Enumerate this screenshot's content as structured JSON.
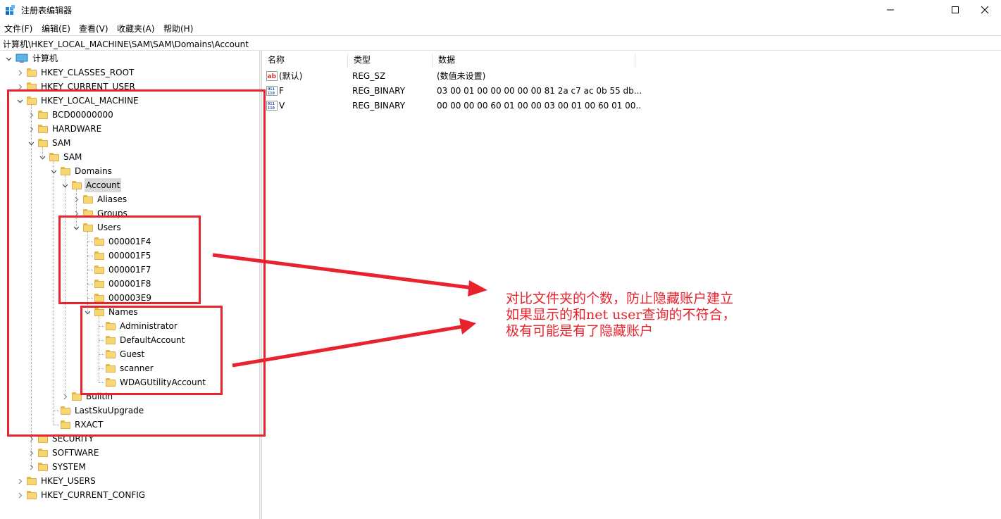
{
  "window": {
    "title": "注册表编辑器",
    "controls": [
      "—",
      "☐",
      "✕"
    ]
  },
  "menu": [
    "文件(F)",
    "编辑(E)",
    "查看(V)",
    "收藏夹(A)",
    "帮助(H)"
  ],
  "address": "计算机\\HKEY_LOCAL_MACHINE\\SAM\\SAM\\Domains\\Account",
  "tree": {
    "root": "计算机",
    "items": [
      {
        "label": "HKEY_CLASSES_ROOT",
        "depth": 1,
        "toggle": "collapsed"
      },
      {
        "label": "HKEY_CURRENT_USER",
        "depth": 1,
        "toggle": "collapsed"
      },
      {
        "label": "HKEY_LOCAL_MACHINE",
        "depth": 1,
        "toggle": "expanded"
      },
      {
        "label": "BCD00000000",
        "depth": 2,
        "toggle": "collapsed"
      },
      {
        "label": "HARDWARE",
        "depth": 2,
        "toggle": "collapsed"
      },
      {
        "label": "SAM",
        "depth": 2,
        "toggle": "expanded"
      },
      {
        "label": "SAM",
        "depth": 3,
        "toggle": "expanded"
      },
      {
        "label": "Domains",
        "depth": 4,
        "toggle": "expanded"
      },
      {
        "label": "Account",
        "depth": 5,
        "toggle": "expanded",
        "selected": true
      },
      {
        "label": "Aliases",
        "depth": 6,
        "toggle": "collapsed"
      },
      {
        "label": "Groups",
        "depth": 6,
        "toggle": "collapsed"
      },
      {
        "label": "Users",
        "depth": 6,
        "toggle": "expanded"
      },
      {
        "label": "000001F4",
        "depth": 7,
        "toggle": "none"
      },
      {
        "label": "000001F5",
        "depth": 7,
        "toggle": "none"
      },
      {
        "label": "000001F7",
        "depth": 7,
        "toggle": "none"
      },
      {
        "label": "000001F8",
        "depth": 7,
        "toggle": "none"
      },
      {
        "label": "000003E9",
        "depth": 7,
        "toggle": "none"
      },
      {
        "label": "Names",
        "depth": 7,
        "toggle": "expanded"
      },
      {
        "label": "Administrator",
        "depth": 8,
        "toggle": "none"
      },
      {
        "label": "DefaultAccount",
        "depth": 8,
        "toggle": "none"
      },
      {
        "label": "Guest",
        "depth": 8,
        "toggle": "none"
      },
      {
        "label": "scanner",
        "depth": 8,
        "toggle": "none"
      },
      {
        "label": "WDAGUtilityAccount",
        "depth": 8,
        "toggle": "none"
      },
      {
        "label": "Builtin",
        "depth": 5,
        "toggle": "collapsed"
      },
      {
        "label": "LastSkuUpgrade",
        "depth": 4,
        "toggle": "none"
      },
      {
        "label": "RXACT",
        "depth": 4,
        "toggle": "none"
      },
      {
        "label": "SECURITY",
        "depth": 2,
        "toggle": "collapsed"
      },
      {
        "label": "SOFTWARE",
        "depth": 2,
        "toggle": "collapsed"
      },
      {
        "label": "SYSTEM",
        "depth": 2,
        "toggle": "collapsed"
      },
      {
        "label": "HKEY_USERS",
        "depth": 1,
        "toggle": "collapsed"
      },
      {
        "label": "HKEY_CURRENT_CONFIG",
        "depth": 1,
        "toggle": "collapsed"
      }
    ]
  },
  "values": {
    "columns": [
      "名称",
      "类型",
      "数据"
    ],
    "rows": [
      {
        "name": "(默认)",
        "type": "REG_SZ",
        "data": "(数值未设置)",
        "icon": "string-value-icon"
      },
      {
        "name": "F",
        "type": "REG_BINARY",
        "data": "03 00 01 00 00 00 00 00 81 2a c7 ac 0b 55 db...",
        "icon": "binary-value-icon"
      },
      {
        "name": "V",
        "type": "REG_BINARY",
        "data": "00 00 00 00 60 01 00 00 03 00 01 00 60 01 00...",
        "icon": "binary-value-icon"
      }
    ]
  },
  "annotation": {
    "text": "对比文件夹的个数，防止隐藏账户建立\n如果显示的和net user查询的不符合，\n极有可能是有了隐藏账户",
    "color": "#e8232e"
  },
  "colors": {
    "selection": "#d9d9d9",
    "folder": "#f7d774",
    "annotation_red": "#e8232e"
  }
}
